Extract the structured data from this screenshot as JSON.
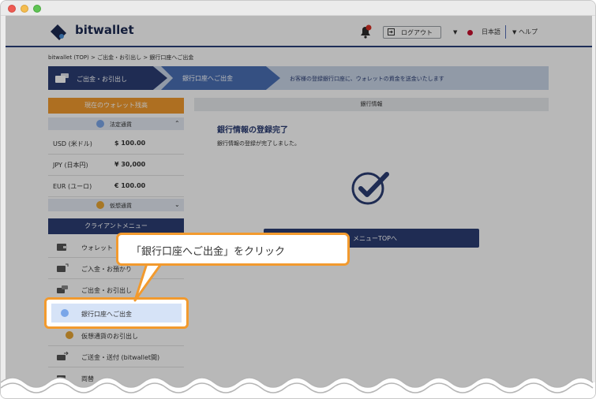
{
  "header": {
    "brand": "bitwallet",
    "logout_label": "ログアウト",
    "language_label": "日本語",
    "help_label": "ヘルプ"
  },
  "breadcrumb": "bitwallet (TOP)  >  ご出金・お引出し  >  銀行口座へご出金",
  "steps": {
    "step1": "ご出金・お引出し",
    "step2": "銀行口座へご出金",
    "description": "お客様の登録銀行口座に、ウォレットの資金を送金いたします"
  },
  "sidebar": {
    "balance_title": "現在のウォレット残高",
    "fiat_title": "法定通貨",
    "balances": [
      {
        "currency": "USD (米ドル)",
        "amount": "$ 100.00"
      },
      {
        "currency": "JPY (日本円)",
        "amount": "¥ 30,000"
      },
      {
        "currency": "EUR (ユーロ)",
        "amount": "€ 100.00"
      }
    ],
    "virtual_title": "仮想通貨",
    "menu_title": "クライアントメニュー",
    "menu_items": [
      {
        "label": "ウォレット"
      },
      {
        "label": "ご入金・お預かり"
      },
      {
        "label": "ご出金・お引出し"
      },
      {
        "label": "銀行口座へご出金"
      },
      {
        "label": "仮想通貨のお引出し"
      },
      {
        "label": "ご送金・送付 (bitwallet間)"
      },
      {
        "label": "両替"
      }
    ]
  },
  "main": {
    "section_title": "銀行情報",
    "title": "銀行情報の登録完了",
    "message": "銀行情報の登録が完了しました。",
    "button_label": "メニューTOPへ"
  },
  "callout": {
    "text": "「銀行口座へご出金」をクリック"
  },
  "colors": {
    "navy": "#2b3d74",
    "accent_orange": "#f29a2e",
    "highlight_blue": "#d6e3f7"
  }
}
